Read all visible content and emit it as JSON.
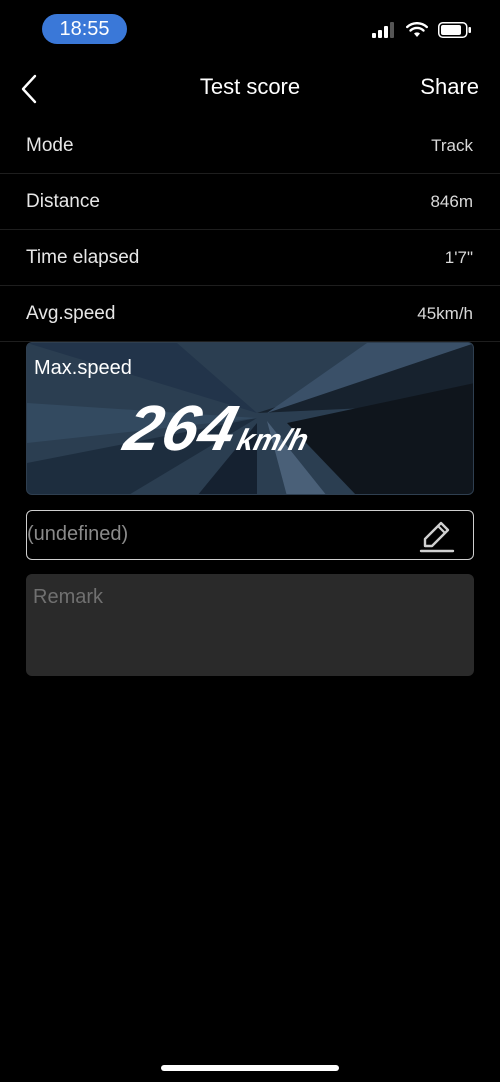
{
  "status_bar": {
    "time": "18:55",
    "icons": [
      "cellular-signal-icon",
      "wifi-icon",
      "battery-icon"
    ]
  },
  "nav": {
    "title": "Test score",
    "back_icon": "chevron-left-icon",
    "share_label": "Share"
  },
  "rows": [
    {
      "label": "Mode",
      "value": "Track"
    },
    {
      "label": "Distance",
      "value": "846m"
    },
    {
      "label": "Time elapsed",
      "value": "1'7\""
    },
    {
      "label": "Avg.speed",
      "value": "45km/h"
    }
  ],
  "max_speed": {
    "label": "Max.speed",
    "value": "264",
    "unit": "km/h"
  },
  "name_field": {
    "value": "(undefined)",
    "edit_icon": "pencil-icon"
  },
  "remark": {
    "placeholder": "Remark"
  },
  "colors": {
    "background": "#000000",
    "time_pill": "#3a78d8",
    "card_bg": "#26384a",
    "remark_bg": "#2a2a2a"
  }
}
